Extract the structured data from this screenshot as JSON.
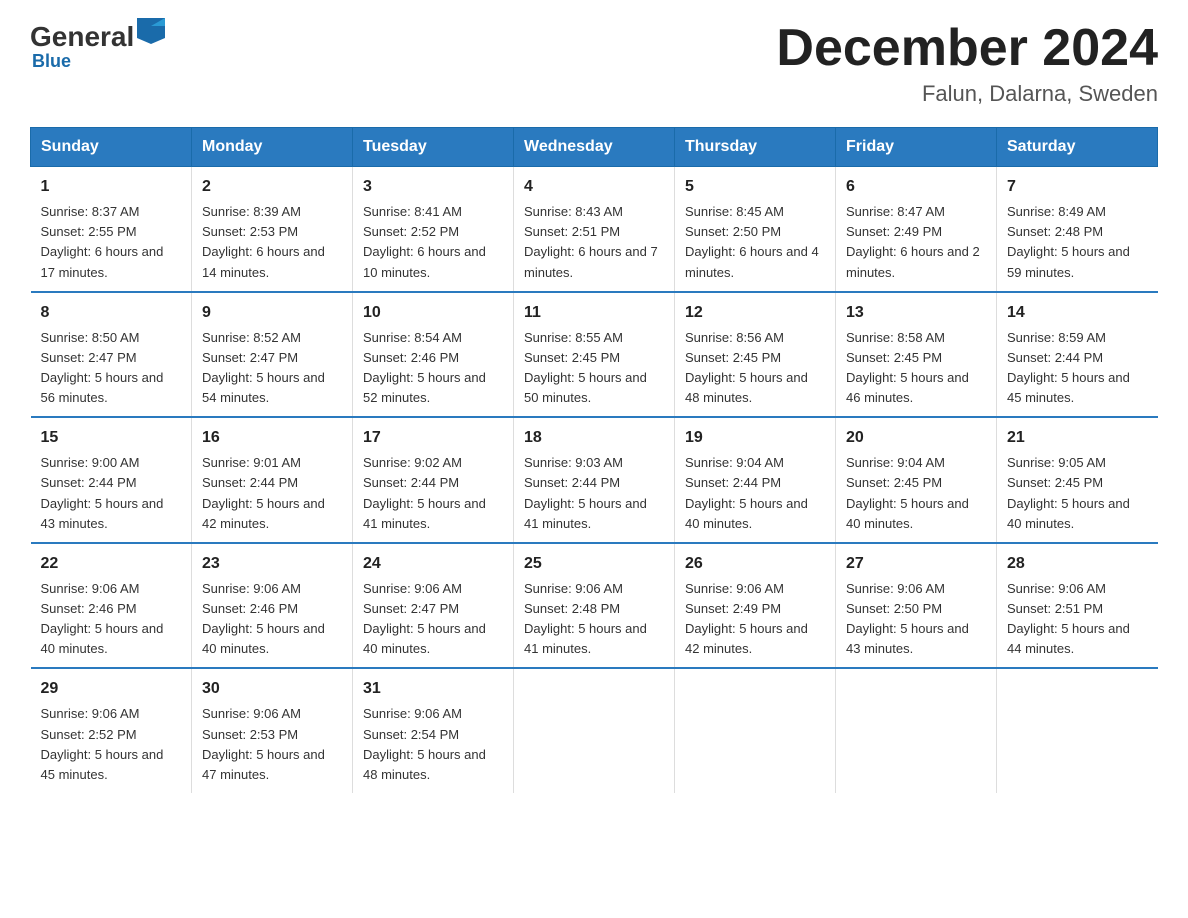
{
  "logo": {
    "general": "General",
    "blue": "Blue",
    "subtitle": "Blue"
  },
  "header": {
    "month": "December 2024",
    "location": "Falun, Dalarna, Sweden"
  },
  "weekdays": [
    "Sunday",
    "Monday",
    "Tuesday",
    "Wednesday",
    "Thursday",
    "Friday",
    "Saturday"
  ],
  "weeks": [
    [
      {
        "day": "1",
        "sunrise": "Sunrise: 8:37 AM",
        "sunset": "Sunset: 2:55 PM",
        "daylight": "Daylight: 6 hours and 17 minutes."
      },
      {
        "day": "2",
        "sunrise": "Sunrise: 8:39 AM",
        "sunset": "Sunset: 2:53 PM",
        "daylight": "Daylight: 6 hours and 14 minutes."
      },
      {
        "day": "3",
        "sunrise": "Sunrise: 8:41 AM",
        "sunset": "Sunset: 2:52 PM",
        "daylight": "Daylight: 6 hours and 10 minutes."
      },
      {
        "day": "4",
        "sunrise": "Sunrise: 8:43 AM",
        "sunset": "Sunset: 2:51 PM",
        "daylight": "Daylight: 6 hours and 7 minutes."
      },
      {
        "day": "5",
        "sunrise": "Sunrise: 8:45 AM",
        "sunset": "Sunset: 2:50 PM",
        "daylight": "Daylight: 6 hours and 4 minutes."
      },
      {
        "day": "6",
        "sunrise": "Sunrise: 8:47 AM",
        "sunset": "Sunset: 2:49 PM",
        "daylight": "Daylight: 6 hours and 2 minutes."
      },
      {
        "day": "7",
        "sunrise": "Sunrise: 8:49 AM",
        "sunset": "Sunset: 2:48 PM",
        "daylight": "Daylight: 5 hours and 59 minutes."
      }
    ],
    [
      {
        "day": "8",
        "sunrise": "Sunrise: 8:50 AM",
        "sunset": "Sunset: 2:47 PM",
        "daylight": "Daylight: 5 hours and 56 minutes."
      },
      {
        "day": "9",
        "sunrise": "Sunrise: 8:52 AM",
        "sunset": "Sunset: 2:47 PM",
        "daylight": "Daylight: 5 hours and 54 minutes."
      },
      {
        "day": "10",
        "sunrise": "Sunrise: 8:54 AM",
        "sunset": "Sunset: 2:46 PM",
        "daylight": "Daylight: 5 hours and 52 minutes."
      },
      {
        "day": "11",
        "sunrise": "Sunrise: 8:55 AM",
        "sunset": "Sunset: 2:45 PM",
        "daylight": "Daylight: 5 hours and 50 minutes."
      },
      {
        "day": "12",
        "sunrise": "Sunrise: 8:56 AM",
        "sunset": "Sunset: 2:45 PM",
        "daylight": "Daylight: 5 hours and 48 minutes."
      },
      {
        "day": "13",
        "sunrise": "Sunrise: 8:58 AM",
        "sunset": "Sunset: 2:45 PM",
        "daylight": "Daylight: 5 hours and 46 minutes."
      },
      {
        "day": "14",
        "sunrise": "Sunrise: 8:59 AM",
        "sunset": "Sunset: 2:44 PM",
        "daylight": "Daylight: 5 hours and 45 minutes."
      }
    ],
    [
      {
        "day": "15",
        "sunrise": "Sunrise: 9:00 AM",
        "sunset": "Sunset: 2:44 PM",
        "daylight": "Daylight: 5 hours and 43 minutes."
      },
      {
        "day": "16",
        "sunrise": "Sunrise: 9:01 AM",
        "sunset": "Sunset: 2:44 PM",
        "daylight": "Daylight: 5 hours and 42 minutes."
      },
      {
        "day": "17",
        "sunrise": "Sunrise: 9:02 AM",
        "sunset": "Sunset: 2:44 PM",
        "daylight": "Daylight: 5 hours and 41 minutes."
      },
      {
        "day": "18",
        "sunrise": "Sunrise: 9:03 AM",
        "sunset": "Sunset: 2:44 PM",
        "daylight": "Daylight: 5 hours and 41 minutes."
      },
      {
        "day": "19",
        "sunrise": "Sunrise: 9:04 AM",
        "sunset": "Sunset: 2:44 PM",
        "daylight": "Daylight: 5 hours and 40 minutes."
      },
      {
        "day": "20",
        "sunrise": "Sunrise: 9:04 AM",
        "sunset": "Sunset: 2:45 PM",
        "daylight": "Daylight: 5 hours and 40 minutes."
      },
      {
        "day": "21",
        "sunrise": "Sunrise: 9:05 AM",
        "sunset": "Sunset: 2:45 PM",
        "daylight": "Daylight: 5 hours and 40 minutes."
      }
    ],
    [
      {
        "day": "22",
        "sunrise": "Sunrise: 9:06 AM",
        "sunset": "Sunset: 2:46 PM",
        "daylight": "Daylight: 5 hours and 40 minutes."
      },
      {
        "day": "23",
        "sunrise": "Sunrise: 9:06 AM",
        "sunset": "Sunset: 2:46 PM",
        "daylight": "Daylight: 5 hours and 40 minutes."
      },
      {
        "day": "24",
        "sunrise": "Sunrise: 9:06 AM",
        "sunset": "Sunset: 2:47 PM",
        "daylight": "Daylight: 5 hours and 40 minutes."
      },
      {
        "day": "25",
        "sunrise": "Sunrise: 9:06 AM",
        "sunset": "Sunset: 2:48 PM",
        "daylight": "Daylight: 5 hours and 41 minutes."
      },
      {
        "day": "26",
        "sunrise": "Sunrise: 9:06 AM",
        "sunset": "Sunset: 2:49 PM",
        "daylight": "Daylight: 5 hours and 42 minutes."
      },
      {
        "day": "27",
        "sunrise": "Sunrise: 9:06 AM",
        "sunset": "Sunset: 2:50 PM",
        "daylight": "Daylight: 5 hours and 43 minutes."
      },
      {
        "day": "28",
        "sunrise": "Sunrise: 9:06 AM",
        "sunset": "Sunset: 2:51 PM",
        "daylight": "Daylight: 5 hours and 44 minutes."
      }
    ],
    [
      {
        "day": "29",
        "sunrise": "Sunrise: 9:06 AM",
        "sunset": "Sunset: 2:52 PM",
        "daylight": "Daylight: 5 hours and 45 minutes."
      },
      {
        "day": "30",
        "sunrise": "Sunrise: 9:06 AM",
        "sunset": "Sunset: 2:53 PM",
        "daylight": "Daylight: 5 hours and 47 minutes."
      },
      {
        "day": "31",
        "sunrise": "Sunrise: 9:06 AM",
        "sunset": "Sunset: 2:54 PM",
        "daylight": "Daylight: 5 hours and 48 minutes."
      },
      null,
      null,
      null,
      null
    ]
  ]
}
